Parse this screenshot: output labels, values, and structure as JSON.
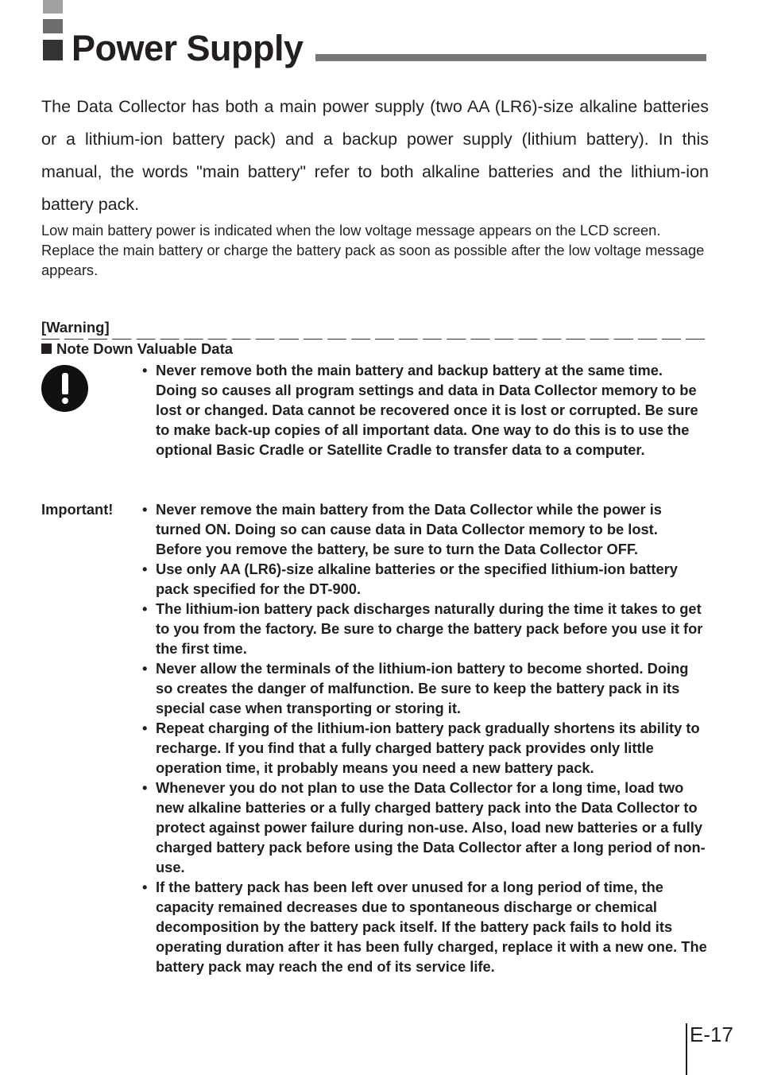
{
  "heading": {
    "title": "Power Supply",
    "colors": {
      "square_light": "#a0a0a0",
      "square_mid": "#6e6e6e",
      "square_dark": "#333333",
      "rule": "#777777"
    }
  },
  "intro": "The Data Collector has both a main power supply (two AA (LR6)-size alkaline batteries or a lithium-ion battery pack) and a backup power supply (lithium battery). In this manual, the words \"main battery\" refer to both alkaline batteries and the lithium-ion battery pack.",
  "note": "Low main battery power is indicated when the low voltage message appears on the LCD screen. Replace the main battery or charge the battery pack as soon as possible after the low voltage message appears.",
  "warning": {
    "label": "[Warning]",
    "subheading": "Note Down Valuable Data",
    "icon": "exclamation-circle-icon",
    "items": [
      "Never remove both the main battery and backup battery at the same time. Doing so causes all program settings and data in Data Collector memory to be lost or changed. Data cannot be recovered once it is lost or corrupted. Be sure to make back-up copies of all important data. One way to do this is to use the optional Basic Cradle or Satellite Cradle to transfer data to a computer."
    ]
  },
  "important": {
    "label": "Important!",
    "items": [
      "Never remove the main battery from the Data Collector while the power is turned ON. Doing so can cause data in Data Collector memory to be lost. Before you remove the battery, be sure to turn the Data Collector OFF.",
      "Use only AA (LR6)-size alkaline batteries or the specified lithium-ion battery pack specified for the DT-900.",
      "The lithium-ion battery pack discharges naturally during the time it takes to get to you from the factory. Be sure to charge the battery pack before you use it for the first time.",
      "Never allow the terminals of the lithium-ion battery to become shorted. Doing so creates the danger of malfunction. Be sure to keep the battery pack in its special case when transporting or storing it.",
      "Repeat charging of the lithium-ion battery pack gradually shortens its ability to recharge. If you find that a fully charged battery pack provides only little operation time, it probably means you need a new battery pack.",
      "Whenever you do not plan to use the Data Collector for a long time, load two new alkaline batteries or a fully charged battery pack into the Data Collector to protect against power failure during non-use. Also, load new batteries or a fully charged battery pack before using the Data Collector after a long period of non-use.",
      "If the battery pack has been left over unused for a long period of time, the capacity remained decreases due to spontaneous discharge or chemical decomposition by the battery pack itself. If the battery pack fails to hold its operating duration after it has been fully charged, replace it with a new one. The battery pack may reach the end of its service life."
    ]
  },
  "footer": {
    "page_number": "E-17"
  }
}
